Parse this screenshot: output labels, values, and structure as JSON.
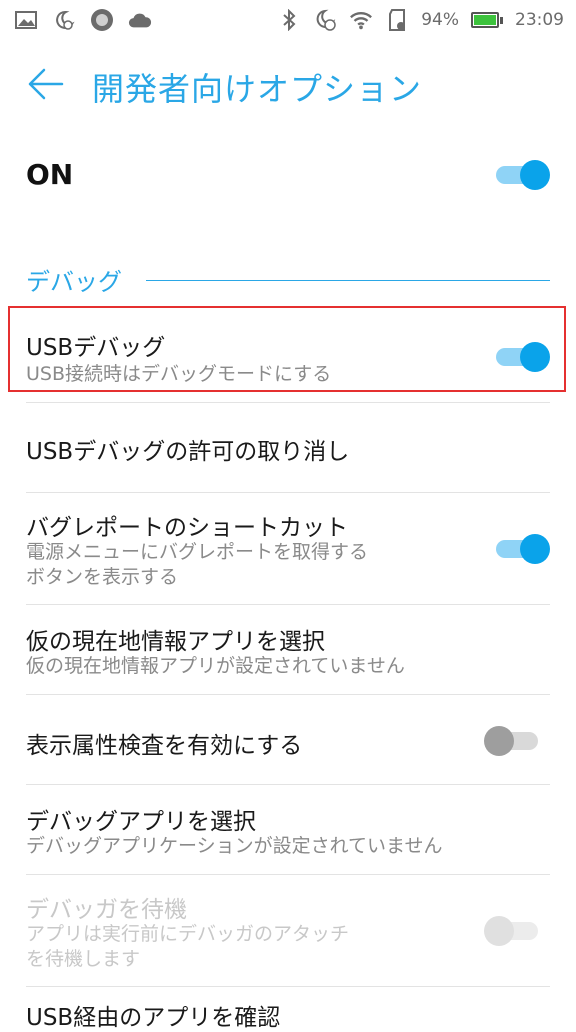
{
  "status_bar": {
    "battery_percent": "94%",
    "time": "23:09",
    "icons_left": [
      "image-icon",
      "moon-clock-icon",
      "circle-app-icon",
      "cloud-icon"
    ],
    "icons_right": [
      "bluetooth-icon",
      "alarm-moon-icon",
      "wifi-icon",
      "sd-card-icon"
    ]
  },
  "appbar": {
    "title": "開発者向けオプション"
  },
  "master": {
    "label": "ON",
    "enabled": true
  },
  "category": {
    "label": "デバッグ"
  },
  "items": [
    {
      "title": "USBデバッグ",
      "summary": "USB接続時はデバッグモードにする",
      "switch": "on"
    },
    {
      "title": "USBデバッグの許可の取り消し"
    },
    {
      "title": "バグレポートのショートカット",
      "summary_line1": "電源メニューにバグレポートを取得する",
      "summary_line2": "ボタンを表示する",
      "switch": "on"
    },
    {
      "title": "仮の現在地情報アプリを選択",
      "summary": "仮の現在地情報アプリが設定されていません"
    },
    {
      "title": "表示属性検査を有効にする",
      "switch": "off"
    },
    {
      "title": "デバッグアプリを選択",
      "summary": "デバッグアプリケーションが設定されていません"
    },
    {
      "title": "デバッガを待機",
      "summary_line1": "アプリは実行前にデバッガのアタッチ",
      "summary_line2": "を待機します",
      "switch": "disabled"
    },
    {
      "title": "USB経由のアプリを確認"
    }
  ],
  "colors": {
    "accent": "#2aa7e6",
    "switch_on": "#0aa3ea",
    "highlight": "#e53030"
  }
}
